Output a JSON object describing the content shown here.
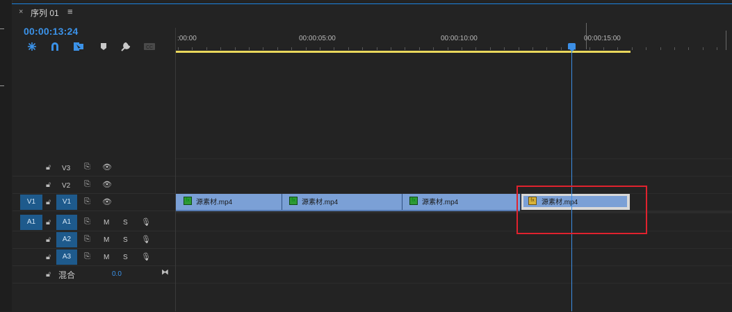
{
  "panel": {
    "close": "×",
    "title": "序列 01",
    "menu": "≡"
  },
  "timecode": "00:00:13:24",
  "toolbar": {
    "tools": [
      "snap-icon",
      "magnet-icon",
      "linked-selection-icon",
      "marker-icon",
      "wrench-icon",
      "captions-icon"
    ],
    "captions_label": "CC"
  },
  "ruler": {
    "times": [
      ":00:00",
      "00:00:05:00",
      "00:00:10:00",
      "00:00:15:00"
    ]
  },
  "tracks": {
    "video": [
      {
        "target": "",
        "name": "V3"
      },
      {
        "target": "",
        "name": "V2"
      },
      {
        "target": "V1",
        "name": "V1"
      }
    ],
    "audio": [
      {
        "target": "A1",
        "name": "A1",
        "mute": "M",
        "solo": "S"
      },
      {
        "target": "",
        "name": "A2",
        "mute": "M",
        "solo": "S"
      },
      {
        "target": "",
        "name": "A3",
        "mute": "M",
        "solo": "S"
      }
    ],
    "mix": {
      "label": "混合",
      "value": "0.0"
    }
  },
  "clips": [
    {
      "name": "源素材.mp4",
      "fx": "fx"
    },
    {
      "name": "源素材.mp4",
      "fx": "fx"
    },
    {
      "name": "源素材.mp4",
      "fx": "fx"
    },
    {
      "name": "源素材.mp4",
      "fx": "fx"
    }
  ],
  "colors": {
    "accent": "#3b92e8",
    "clip": "#7ba0d6",
    "work_area": "#e9d75b",
    "highlight": "#e0222e",
    "track_target": "#1e5a8c"
  }
}
